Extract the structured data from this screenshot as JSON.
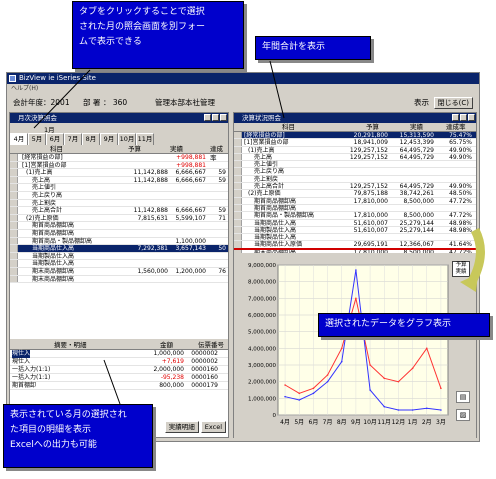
{
  "callouts": {
    "tab_line1": "タブをクリックすることで選択",
    "tab_line2": "された月の照会画面を別フォー",
    "tab_line3": "ムで表示できる",
    "annual": "年間合計を表示",
    "graph": "選択されたデータをグラフ表示",
    "detail_line1": "表示されている月の選択され",
    "detail_line2": "た項目の明細を表示",
    "detail_line3": "Excelへの出力も可能"
  },
  "app": {
    "title": "BizView   ie iSeries Site",
    "menu": "ヘルプ(H)",
    "fiscal_year": "会計年度：2001",
    "dept_label": "部 署",
    "dept_code": "：  360",
    "dept_name": "管理本部本社管理",
    "display_label": "表示",
    "close_label": "閉じる(C)"
  },
  "left_panel": {
    "title": "月次決算照会",
    "tab_header": "1月",
    "tabs": [
      "4月",
      "5月",
      "6月",
      "7月",
      "8月",
      "9月",
      "10月",
      "11月"
    ],
    "columns": {
      "subject": "科目",
      "budget": "予算",
      "actual": "実績",
      "rate": "達成率"
    },
    "rows": [
      {
        "name": "[経常損益の部]",
        "budget": "",
        "actual": "+998,881",
        "rate": "",
        "red": true
      },
      {
        "name": "[1]営業損益の部",
        "budget": "",
        "actual": "+998,881",
        "rate": "",
        "red": true
      },
      {
        "name": "(1)売上高",
        "budget": "11,142,888",
        "actual": "6,666,667",
        "rate": "59",
        "red": false
      },
      {
        "name": "売上高",
        "budget": "11,142,888",
        "actual": "6,666,667",
        "rate": "59",
        "red": false
      },
      {
        "name": "売上値引",
        "budget": "",
        "actual": "",
        "rate": "",
        "red": false
      },
      {
        "name": "売上戻り高",
        "budget": "",
        "actual": "",
        "rate": "",
        "red": false
      },
      {
        "name": "売上割戻",
        "budget": "",
        "actual": "",
        "rate": "",
        "red": false
      },
      {
        "name": "売上高合計",
        "budget": "11,142,888",
        "actual": "6,666,667",
        "rate": "59",
        "red": false
      },
      {
        "name": "(2)売上原価",
        "budget": "7,815,631",
        "actual": "5,599,107",
        "rate": "71",
        "red": false
      },
      {
        "name": "期首商品棚卸高",
        "budget": "",
        "actual": "",
        "rate": "",
        "red": false
      },
      {
        "name": "期首商品棚卸高",
        "budget": "",
        "actual": "",
        "rate": "",
        "red": false
      },
      {
        "name": "期首商品・製品棚卸高",
        "budget": "",
        "actual": "1,100,000",
        "rate": "",
        "red": false
      },
      {
        "name": "当期商品仕入高",
        "budget": "7,292,381",
        "actual": "3,657,143",
        "rate": "50",
        "red": false,
        "sel": true
      },
      {
        "name": "当期製品仕入高",
        "budget": "",
        "actual": "",
        "rate": "",
        "red": false
      },
      {
        "name": "当期製品仕入高",
        "budget": "",
        "actual": "",
        "rate": "",
        "red": false
      },
      {
        "name": "期末商品棚卸高",
        "budget": "1,560,000",
        "actual": "1,200,000",
        "rate": "76",
        "red": false
      },
      {
        "name": "期末商品棚卸高",
        "budget": "",
        "actual": "",
        "rate": "",
        "red": false
      }
    ],
    "detail_columns": {
      "summary": "摘要・明細",
      "amount": "金額",
      "voucher": "伝票番号"
    },
    "detail_rows": [
      {
        "summary": "現仕入",
        "amount": "1,000,000",
        "voucher": "0000002",
        "red": false
      },
      {
        "summary": "現仕入",
        "amount": "+7,619",
        "voucher": "0000002",
        "red": true
      },
      {
        "summary": "一括入力(1:1)",
        "amount": "2,000,000",
        "voucher": "0000160",
        "red": false
      },
      {
        "summary": "一括入力(1:1)",
        "amount": "-95,238",
        "voucher": "0000160",
        "red": true
      },
      {
        "summary": "期首棚卸",
        "amount": "800,000",
        "voucher": "0000179",
        "red": false
      }
    ],
    "buttons": {
      "detail": "実績明細",
      "excel": "Excel"
    }
  },
  "right_panel": {
    "title": "決算状況照会",
    "columns": {
      "subject": "科目",
      "budget": "予算",
      "actual": "実績",
      "rate": "達成率"
    },
    "rows": [
      {
        "name": "[経常損益の部]",
        "budget": "20,291,800",
        "actual": "15,313,590",
        "rate": "75.47%",
        "sel": true
      },
      {
        "name": "[1]営業損益の部",
        "budget": "18,941,009",
        "actual": "12,453,399",
        "rate": "65.75%"
      },
      {
        "name": "(1)売上高",
        "budget": "129,257,152",
        "actual": "64,495,729",
        "rate": "49.90%"
      },
      {
        "name": "売上高",
        "budget": "129,257,152",
        "actual": "64,495,729",
        "rate": "49.90%"
      },
      {
        "name": "売上値引",
        "budget": "",
        "actual": "",
        "rate": ""
      },
      {
        "name": "売上戻り高",
        "budget": "",
        "actual": "",
        "rate": ""
      },
      {
        "name": "売上割戻",
        "budget": "",
        "actual": "",
        "rate": ""
      },
      {
        "name": "売上高合計",
        "budget": "129,257,152",
        "actual": "64,495,729",
        "rate": "49.90%"
      },
      {
        "name": "(2)売上原価",
        "budget": "79,875,188",
        "actual": "38,742,261",
        "rate": "48.50%"
      },
      {
        "name": "期首商品棚卸高",
        "budget": "17,810,000",
        "actual": "8,500,000",
        "rate": "47.72%"
      },
      {
        "name": "期首商品棚卸高",
        "budget": "",
        "actual": "",
        "rate": ""
      },
      {
        "name": "期首商品・製品棚卸高",
        "budget": "17,810,000",
        "actual": "8,500,000",
        "rate": "47.72%"
      },
      {
        "name": "当期商品仕入高",
        "budget": "51,610,007",
        "actual": "25,279,144",
        "rate": "48.98%"
      },
      {
        "name": "当期製品仕入高",
        "budget": "51,610,007",
        "actual": "25,279,144",
        "rate": "48.98%"
      },
      {
        "name": "当期製品仕入高",
        "budget": "",
        "actual": "",
        "rate": ""
      },
      {
        "name": "当期商品仕入原価",
        "budget": "29,695,191",
        "actual": "12,366,067",
        "rate": "41.64%"
      },
      {
        "name": "期末商品棚卸高",
        "budget": "17,810,000",
        "actual": "8,500,000",
        "rate": "47.72%"
      }
    ],
    "legend": {
      "line1": "予算",
      "line2": "実績"
    }
  },
  "chart_data": {
    "type": "line",
    "categories": [
      "4月",
      "5月",
      "6月",
      "7月",
      "8月",
      "9月",
      "10月",
      "11月",
      "12月",
      "1月",
      "2月",
      "3月"
    ],
    "y_ticks": [
      "9,000,000",
      "8,000,000",
      "7,000,000",
      "6,000,000",
      "5,000,000",
      "4,000,000",
      "3,000,000",
      "2,000,000",
      "1,000,000",
      "0"
    ],
    "ylim": [
      0,
      9000000
    ],
    "grid": true,
    "series": [
      {
        "color": "#ff3333",
        "values": [
          1800000,
          1300000,
          1600000,
          2400000,
          4000000,
          7000000,
          3000000,
          2200000,
          2000000,
          2800000,
          4000000,
          1600000
        ]
      },
      {
        "color": "#3333ff",
        "values": [
          1100000,
          900000,
          1300000,
          2000000,
          3200000,
          8700000,
          1500000,
          500000,
          300000,
          300000,
          400000,
          300000
        ]
      }
    ]
  }
}
